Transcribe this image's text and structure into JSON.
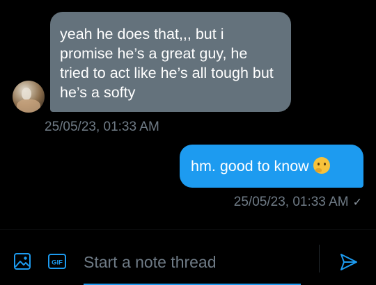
{
  "messages": {
    "incoming": {
      "text": "yeah he does that,,, but i promise he’s a great guy, he tried to act like he’s all tough but he’s a softy",
      "timestamp": "25/05/23, 01:33 AM"
    },
    "outgoing": {
      "text": "hm. good to know",
      "emoji": "thinking-face-emoji",
      "timestamp": "25/05/23, 01:33 AM",
      "status_mark": "✓"
    }
  },
  "composer": {
    "placeholder": "Start a note thread",
    "gif_label": "GIF",
    "icons": [
      "image-icon",
      "gif-icon",
      "send-icon"
    ]
  },
  "colors": {
    "background": "#000000",
    "incoming_bubble": "#64727c",
    "outgoing_bubble": "#1d9bf0",
    "accent": "#1d9bf0",
    "muted_text": "#6f7b86"
  }
}
